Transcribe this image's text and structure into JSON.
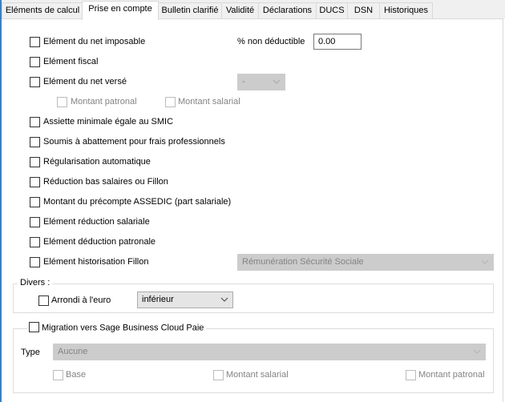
{
  "tabs": [
    {
      "label": "Eléments de calcul",
      "active": false
    },
    {
      "label": "Prise en compte",
      "active": true
    },
    {
      "label": "Bulletin clarifié",
      "active": false
    },
    {
      "label": "Validité",
      "active": false
    },
    {
      "label": "Déclarations",
      "active": false
    },
    {
      "label": "DUCS",
      "active": false
    },
    {
      "label": "DSN",
      "active": false
    },
    {
      "label": "Historiques",
      "active": false
    }
  ],
  "options": {
    "net_imposable": {
      "label": "Elément du net imposable",
      "checked": false
    },
    "non_deductible": {
      "label": "% non déductible",
      "value": "0.00"
    },
    "fiscal": {
      "label": "Elément fiscal",
      "checked": false
    },
    "net_verse": {
      "label": "Elément du net versé",
      "checked": false,
      "select_value": "-"
    },
    "montant_patronal": {
      "label": "Montant patronal",
      "checked": false,
      "disabled": true
    },
    "montant_salarial": {
      "label": "Montant salarial",
      "checked": false,
      "disabled": true
    },
    "assiette_smic": {
      "label": "Assiette minimale égale au SMIC",
      "checked": false
    },
    "abattement": {
      "label": "Soumis à abattement pour frais professionnels",
      "checked": false
    },
    "regularisation": {
      "label": "Régularisation automatique",
      "checked": false
    },
    "reduction_fillon": {
      "label": "Réduction bas salaires ou Fillon",
      "checked": false
    },
    "precompte_assedic": {
      "label": "Montant du précompte ASSEDIC (part salariale)",
      "checked": false
    },
    "reduction_salariale": {
      "label": "Elément réduction salariale",
      "checked": false
    },
    "deduction_patronale": {
      "label": "Elément déduction patronale",
      "checked": false
    },
    "historisation_fillon": {
      "label": "Elément historisation Fillon",
      "checked": false,
      "select_value": "Rémunération Sécurité Sociale"
    }
  },
  "divers": {
    "legend": "Divers :",
    "arrondi": {
      "label": "Arrondi à l'euro",
      "checked": false,
      "select_value": "inférieur"
    }
  },
  "migration": {
    "legend": "Migration vers Sage Business Cloud Paie",
    "checked": false,
    "type_label": "Type",
    "type_value": "Aucune",
    "base": {
      "label": "Base",
      "checked": false,
      "disabled": true
    },
    "montant_salarial": {
      "label": "Montant salarial",
      "checked": false,
      "disabled": true
    },
    "montant_patronal": {
      "label": "Montant patronal",
      "checked": false,
      "disabled": true
    }
  }
}
